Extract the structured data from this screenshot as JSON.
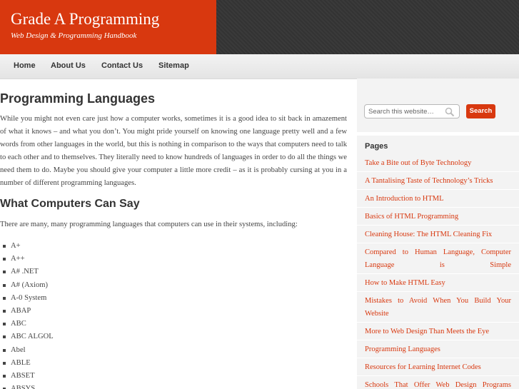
{
  "site": {
    "title": "Grade A Programming",
    "tagline": "Web Design & Programming Handbook"
  },
  "nav": {
    "items": [
      "Home",
      "About Us",
      "Contact Us",
      "Sitemap"
    ]
  },
  "article": {
    "title": "Programming Languages",
    "paragraph": "While you might not even care just how a computer works, sometimes it is a good idea to sit back in amazement of what it knows – and what you don’t. You might pride yourself on knowing one language pretty well and a few words from other languages in the world, but this is nothing in comparison to the ways that computers need to talk to each other and to themselves. They literally need to know hundreds of languages in order to do all the things we need them to do. Maybe you should give your computer a little more credit – as it is probably cursing at you in a number of different programming languages.",
    "subheading": "What Computers Can Say",
    "intro": "There are many, many programming languages that computers can use in their systems, including:",
    "languages": [
      "A+",
      "A++",
      "A# .NET",
      "A# (Axiom)",
      "A-0 System",
      "ABAP",
      "ABC",
      "ABC ALGOL",
      "Abel",
      "ABLE",
      "ABSET",
      "ABSYS"
    ]
  },
  "sidebar": {
    "search": {
      "placeholder": "Search this website…",
      "button_label": "Search",
      "icon": "magnifier-icon"
    },
    "pages_title": "Pages",
    "pages": [
      "Take a Bite out of Byte Technology",
      "A Tantalising Taste of Technology’s Tricks",
      "An Introduction to HTML",
      "Basics of HTML Programming",
      "Cleaning House: The HTML Cleaning Fix",
      "Compared to Human Language, Computer Language is Simple",
      "How to Make HTML Easy",
      "Mistakes to Avoid When You Build Your Website",
      "More to Web Design Than Meets the Eye",
      "Programming Languages",
      "Resources for Learning Internet Codes",
      "Schools That Offer Web Design Programs"
    ]
  },
  "colors": {
    "accent": "#d8380f",
    "header_dark": "#363636",
    "nav_bg": "#ebebeb",
    "sidebar_bg": "#f3f3f3"
  }
}
